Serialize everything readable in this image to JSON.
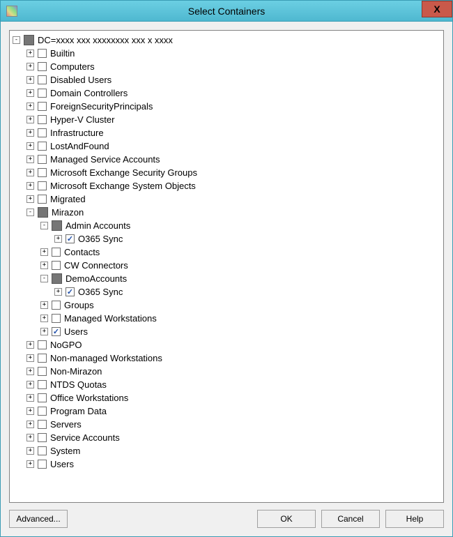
{
  "window": {
    "title": "Select Containers",
    "close_label": "X"
  },
  "buttons": {
    "advanced": "Advanced...",
    "ok": "OK",
    "cancel": "Cancel",
    "help": "Help"
  },
  "tree": {
    "root": {
      "label": "DC=",
      "blurred_suffix": "xxxx xxx xxxxxxxx xxx x xxxx",
      "state": "partial",
      "expanded": true
    },
    "top_items": [
      {
        "label": "Builtin",
        "state": "unchecked",
        "expander": "+"
      },
      {
        "label": "Computers",
        "state": "unchecked",
        "expander": "+"
      },
      {
        "label": "Disabled Users",
        "state": "unchecked",
        "expander": "+"
      },
      {
        "label": "Domain Controllers",
        "state": "unchecked",
        "expander": "+"
      },
      {
        "label": "ForeignSecurityPrincipals",
        "state": "unchecked",
        "expander": "+"
      },
      {
        "label": "Hyper-V Cluster",
        "state": "unchecked",
        "expander": "+"
      },
      {
        "label": "Infrastructure",
        "state": "unchecked",
        "expander": "+"
      },
      {
        "label": "LostAndFound",
        "state": "unchecked",
        "expander": "+"
      },
      {
        "label": "Managed Service Accounts",
        "state": "unchecked",
        "expander": "+"
      },
      {
        "label": "Microsoft Exchange Security Groups",
        "state": "unchecked",
        "expander": "+"
      },
      {
        "label": "Microsoft Exchange System Objects",
        "state": "unchecked",
        "expander": "+"
      },
      {
        "label": "Migrated",
        "state": "unchecked",
        "expander": "+"
      }
    ],
    "mirazon": {
      "label": "Mirazon",
      "state": "partial",
      "expander": "-",
      "children": [
        {
          "label": "Admin Accounts",
          "state": "partial",
          "expander": "-",
          "children": [
            {
              "label": "O365 Sync",
              "state": "checked",
              "expander": "+"
            }
          ]
        },
        {
          "label": "Contacts",
          "state": "unchecked",
          "expander": "+"
        },
        {
          "label": "CW Connectors",
          "state": "unchecked",
          "expander": "+"
        },
        {
          "label": "DemoAccounts",
          "state": "partial",
          "expander": "-",
          "children": [
            {
              "label": "O365 Sync",
              "state": "checked",
              "expander": "+"
            }
          ]
        },
        {
          "label": "Groups",
          "state": "unchecked",
          "expander": "+"
        },
        {
          "label": "Managed Workstations",
          "state": "unchecked",
          "expander": "+"
        },
        {
          "label": "Users",
          "state": "checked",
          "expander": "+"
        }
      ]
    },
    "bottom_items": [
      {
        "label": "NoGPO",
        "state": "unchecked",
        "expander": "+"
      },
      {
        "label": "Non-managed Workstations",
        "state": "unchecked",
        "expander": "+"
      },
      {
        "label": "Non-Mirazon",
        "state": "unchecked",
        "expander": "+"
      },
      {
        "label": "NTDS Quotas",
        "state": "unchecked",
        "expander": "+"
      },
      {
        "label": "Office Workstations",
        "state": "unchecked",
        "expander": "+"
      },
      {
        "label": "Program Data",
        "state": "unchecked",
        "expander": "+"
      },
      {
        "label": "Servers",
        "state": "unchecked",
        "expander": "+"
      },
      {
        "label": "Service Accounts",
        "state": "unchecked",
        "expander": "+"
      },
      {
        "label": "System",
        "state": "unchecked",
        "expander": "+"
      },
      {
        "label": "Users",
        "state": "unchecked",
        "expander": "+"
      }
    ]
  }
}
